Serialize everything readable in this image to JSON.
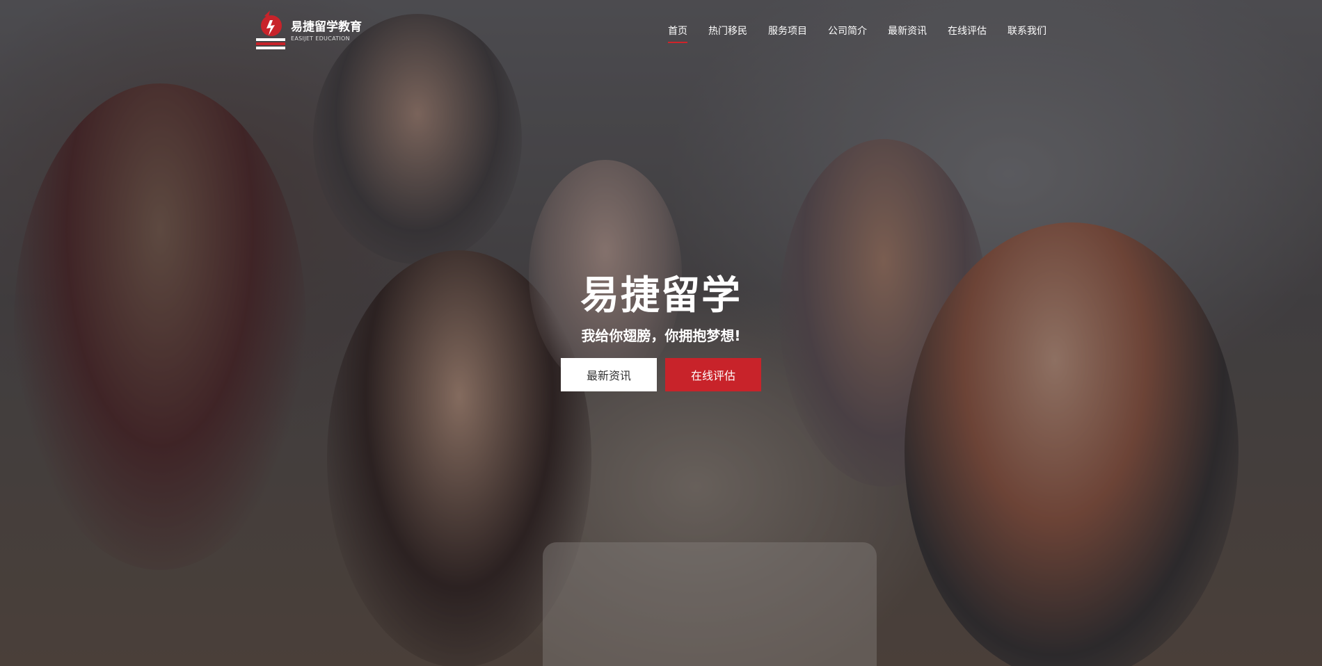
{
  "logo": {
    "name_cn": "易捷留学教育",
    "name_en": "EASIJET EDUCATION",
    "icon": "logo-mark-icon"
  },
  "nav": {
    "items": [
      {
        "label": "首页",
        "active": true
      },
      {
        "label": "热门移民",
        "active": false
      },
      {
        "label": "服务项目",
        "active": false
      },
      {
        "label": "公司简介",
        "active": false
      },
      {
        "label": "最新资讯",
        "active": false
      },
      {
        "label": "在线评估",
        "active": false
      },
      {
        "label": "联系我们",
        "active": false
      }
    ]
  },
  "hero": {
    "title": "易捷留学",
    "subtitle": "我给你翅膀，你拥抱梦想!",
    "btn_news": "最新资讯",
    "btn_assess": "在线评估"
  },
  "colors": {
    "accent": "#c8232a",
    "text": "#ffffff"
  }
}
